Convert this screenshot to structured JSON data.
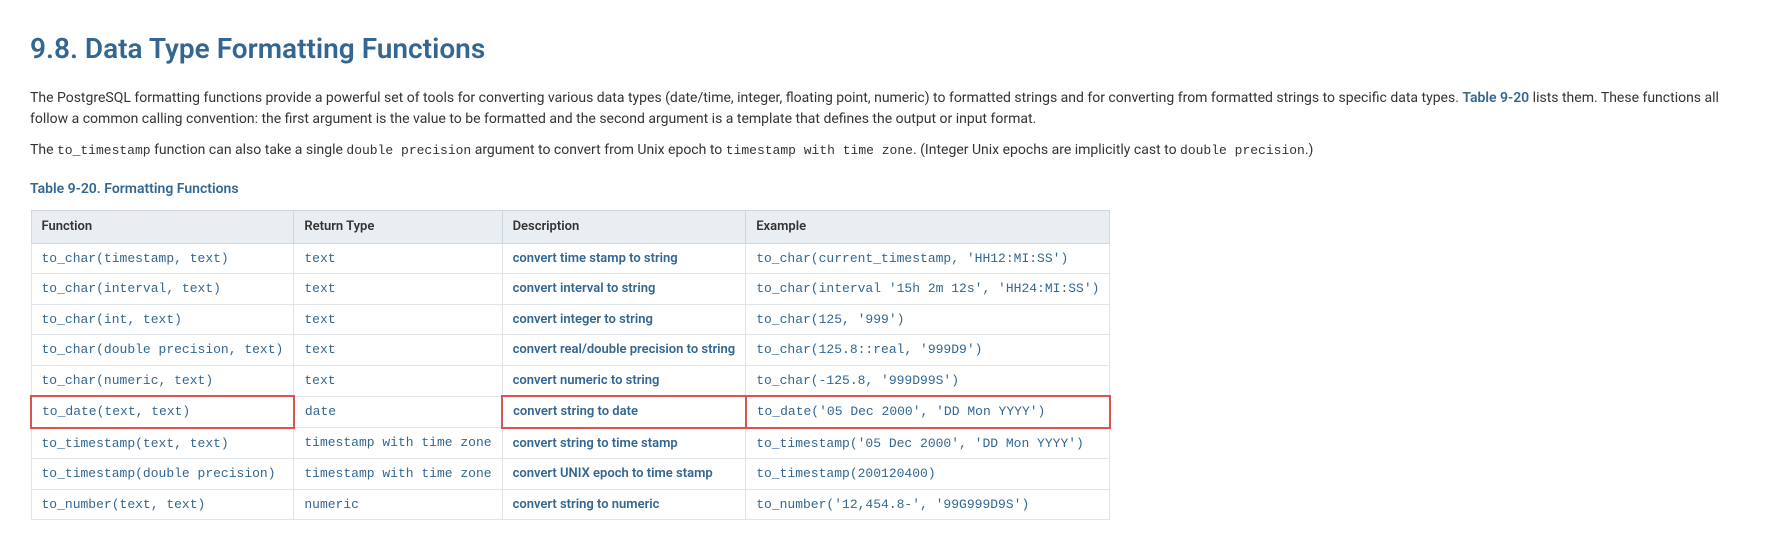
{
  "heading": "9.8. Data Type Formatting Functions",
  "intro": {
    "p1_a": "The PostgreSQL formatting functions provide a powerful set of tools for converting various data types (date/time, integer, floating point, numeric) to formatted strings and for converting from formatted strings to specific data types. ",
    "p1_link": "Table 9-20",
    "p1_b": " lists them. These functions all follow a common calling convention: the first argument is the value to be formatted and the second argument is a template that defines the output or input format.",
    "p2_a": "The ",
    "p2_code1": "to_timestamp",
    "p2_b": " function can also take a single ",
    "p2_code2": "double precision",
    "p2_c": " argument to convert from Unix epoch to ",
    "p2_code3": "timestamp with time zone",
    "p2_d": ". (Integer Unix epochs are implicitly cast to ",
    "p2_code4": "double precision",
    "p2_e": ".)"
  },
  "table_caption": "Table 9-20. Formatting Functions",
  "headers": {
    "c0": "Function",
    "c1": "Return Type",
    "c2": "Description",
    "c3": "Example"
  },
  "rows": [
    {
      "func": "to_char(timestamp, text)",
      "retn": "text",
      "desc": "convert time stamp to string",
      "examp": "to_char(current_timestamp, 'HH12:MI:SS')",
      "hl": [
        false,
        false,
        false,
        false
      ]
    },
    {
      "func": "to_char(interval, text)",
      "retn": "text",
      "desc": "convert interval to string",
      "examp": "to_char(interval '15h  2m  12s', 'HH24:MI:SS')",
      "hl": [
        false,
        false,
        false,
        false
      ]
    },
    {
      "func": "to_char(int, text)",
      "retn": "text",
      "desc": "convert integer to string",
      "examp": "to_char(125, '999')",
      "hl": [
        false,
        false,
        false,
        false
      ]
    },
    {
      "func": "to_char(double precision, text)",
      "retn": "text",
      "desc": "convert real/double precision to string",
      "examp": "to_char(125.8::real, '999D9')",
      "hl": [
        false,
        false,
        false,
        false
      ]
    },
    {
      "func": "to_char(numeric, text)",
      "retn": "text",
      "desc": "convert numeric to string",
      "examp": "to_char(-125.8, '999D99S')",
      "hl": [
        false,
        false,
        false,
        false
      ]
    },
    {
      "func": "to_date(text, text)",
      "retn": "date",
      "desc": "convert string to date",
      "examp": "to_date('05  Dec  2000', 'DD  Mon  YYYY')",
      "hl": [
        true,
        false,
        true,
        true
      ]
    },
    {
      "func": "to_timestamp(text, text)",
      "retn": "timestamp with time zone",
      "desc": "convert string to time stamp",
      "examp": "to_timestamp('05  Dec  2000', 'DD  Mon  YYYY')",
      "hl": [
        false,
        false,
        false,
        false
      ]
    },
    {
      "func": "to_timestamp(double precision)",
      "retn": "timestamp with time zone",
      "desc": "convert UNIX epoch to time stamp",
      "examp": "to_timestamp(200120400)",
      "hl": [
        false,
        false,
        false,
        false
      ]
    },
    {
      "func": "to_number(text, text)",
      "retn": "numeric",
      "desc": "convert string to numeric",
      "examp": "to_number('12,454.8-', '99G999D9S')",
      "hl": [
        false,
        false,
        false,
        false
      ]
    }
  ]
}
